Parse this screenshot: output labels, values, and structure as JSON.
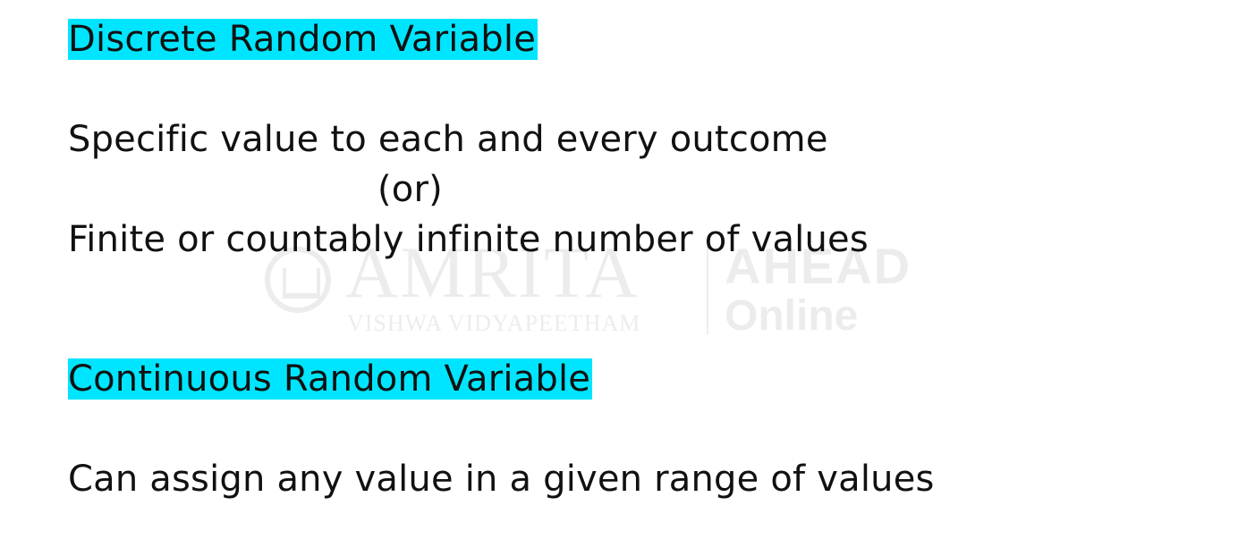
{
  "slide": {
    "discrete_heading": "Discrete Random Variable",
    "discrete_line1": "Specific value to each and every outcome",
    "discrete_or": "(or)",
    "discrete_line2": "Finite or countably infinite number of values",
    "continuous_heading": "Continuous Random Variable",
    "continuous_line1": "Can assign any value in a given range of values",
    "highlight_color": "#00e5ff"
  },
  "watermark": {
    "brand": "AMRITA",
    "subtitle": "VISHWA VIDYAPEETHAM",
    "program": "AHEAD",
    "program_sub": "Online",
    "emblem_icon": "amrita-emblem-icon"
  }
}
